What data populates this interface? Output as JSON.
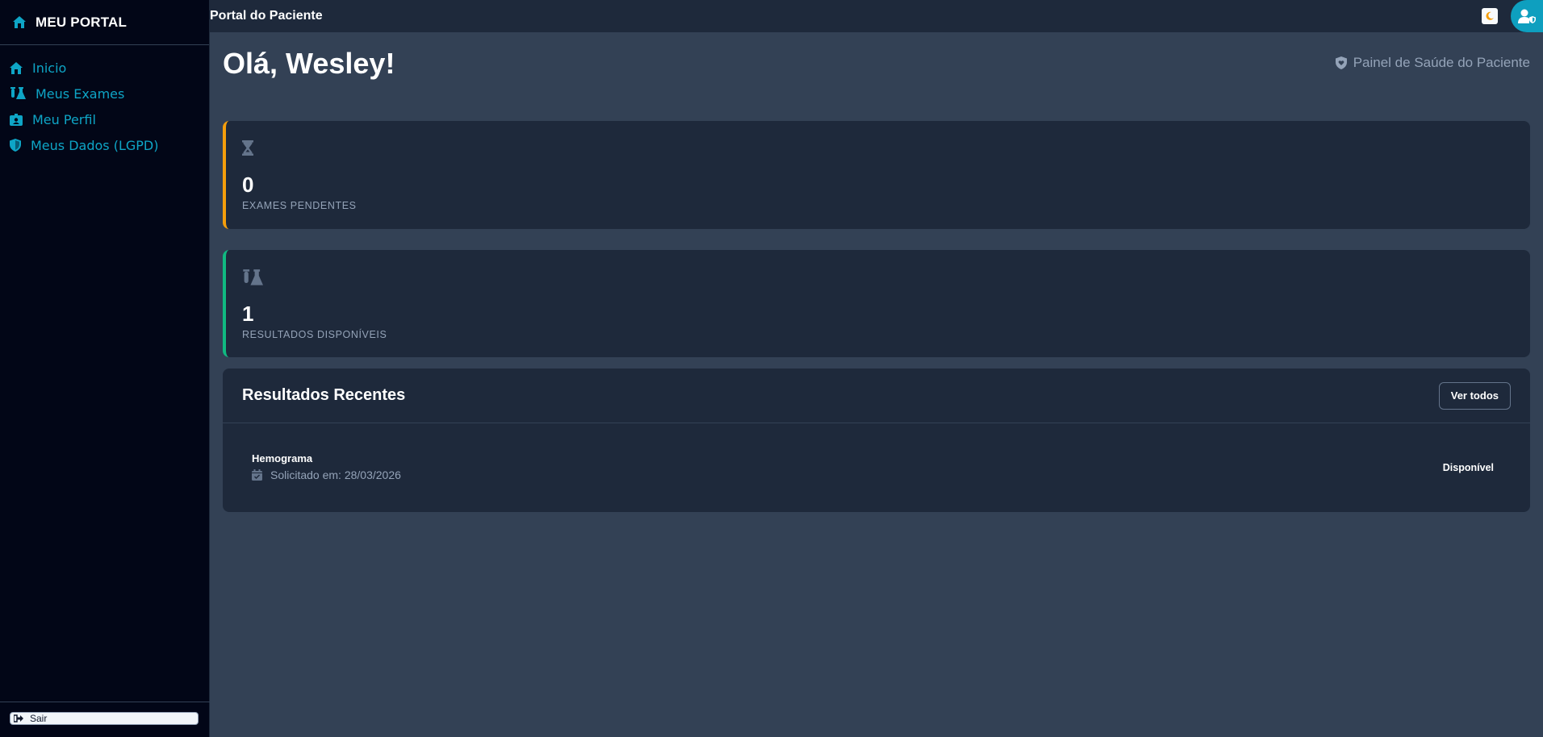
{
  "sidebar": {
    "brand": "MEU PORTAL",
    "brand_icon": "home-icon",
    "items": [
      {
        "label": "Inicio",
        "icon": "home-icon"
      },
      {
        "label": "Meus Exames",
        "icon": "flask-icon"
      },
      {
        "label": "Meu Perfil",
        "icon": "id-badge-icon"
      },
      {
        "label": "Meus Dados (LGPD)",
        "icon": "shield-icon"
      }
    ],
    "logout_label": "Sair"
  },
  "topbar": {
    "title": "Portal do Paciente"
  },
  "main": {
    "greeting": "Olá, Wesley!",
    "panel_tag": "Painel de Saúde do Paciente",
    "stats": [
      {
        "value": "0",
        "label": "EXAMES PENDENTES",
        "accent": "#f59e0b",
        "icon": "hourglass-icon"
      },
      {
        "value": "1",
        "label": "RESULTADOS DISPONÍVEIS",
        "accent": "#10b981",
        "icon": "flask-icon"
      }
    ],
    "recent": {
      "title": "Resultados Recentes",
      "button": "Ver todos",
      "items": [
        {
          "name": "Hemograma",
          "date": "Solicitado em: 28/03/2026",
          "status": "Disponível"
        }
      ]
    }
  },
  "colors": {
    "sidebar_bg": "#020617",
    "page_bg": "#334155",
    "card_bg": "#1e293b",
    "accent": "#0ea5c6"
  }
}
